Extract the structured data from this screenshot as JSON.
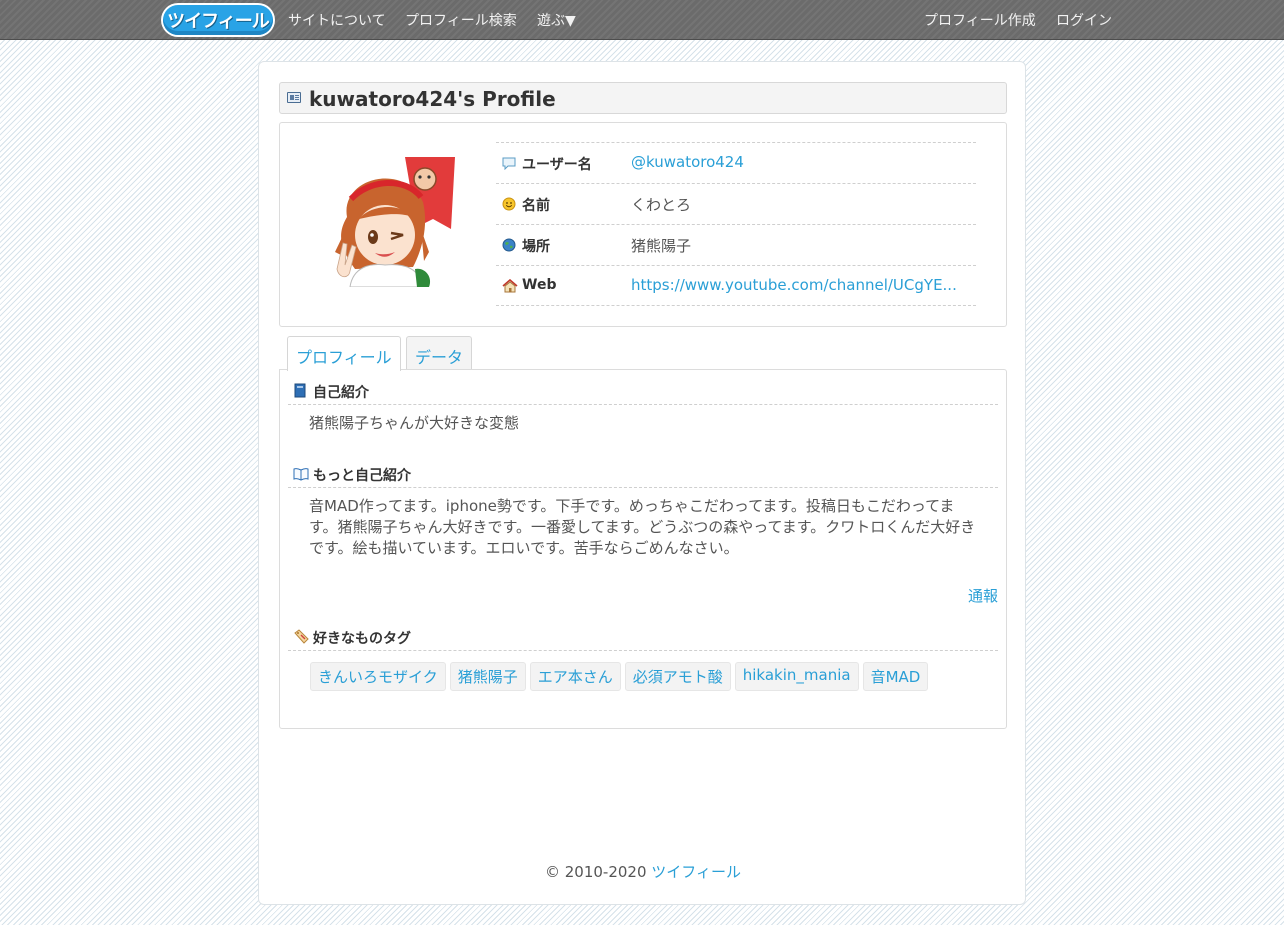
{
  "nav": {
    "logo_text": "ツイフィール",
    "items": [
      "サイトについて",
      "プロフィール検索",
      "遊ぶ▼"
    ],
    "right_items": [
      "プロフィール作成",
      "ログイン"
    ]
  },
  "page": {
    "title": "kuwatoro424's Profile"
  },
  "profile": {
    "fields": [
      {
        "icon": "speech-bubble-icon",
        "label": "ユーザー名",
        "value": "@kuwatoro424",
        "link": true
      },
      {
        "icon": "smiley-icon",
        "label": "名前",
        "value": "くわとろ",
        "link": false
      },
      {
        "icon": "globe-icon",
        "label": "場所",
        "value": "猪熊陽子",
        "link": false
      },
      {
        "icon": "home-icon",
        "label": "Web",
        "value": "https://www.youtube.com/channel/UCgYE...",
        "link": true
      }
    ]
  },
  "tabs": [
    "プロフィール",
    "データ"
  ],
  "sections": {
    "intro": {
      "label": "自己紹介",
      "text": "猪熊陽子ちゃんが大好きな変態"
    },
    "more_intro": {
      "label": "もっと自己紹介",
      "text": "音MAD作ってます。iphone勢です。下手です。めっちゃこだわってます。投稿日もこだわってます。猪熊陽子ちゃん大好きです。一番愛してます。どうぶつの森やってます。クワトロくんだ大好きです。絵も描いています。エロいです。苦手ならごめんなさい。"
    },
    "report": "通報",
    "tags": {
      "label": "好きなものタグ",
      "items": [
        "きんいろモザイク",
        "猪熊陽子",
        "エア本さん",
        "必須アモト酸",
        "hikakin_mania",
        "音MAD"
      ]
    }
  },
  "footer": {
    "copyright": "© 2010-2020",
    "site_link": "ツイフィール"
  },
  "colors": {
    "link": "#2a9fd6",
    "navbar": "#6b6b6b",
    "logo": "#29a3e6"
  }
}
